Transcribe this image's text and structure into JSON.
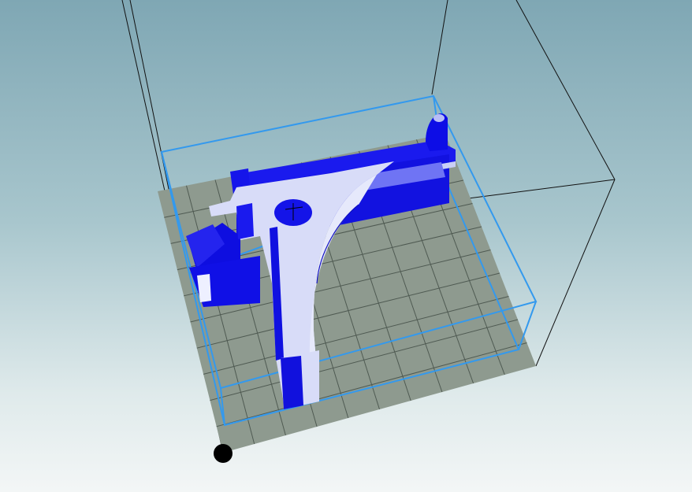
{
  "viewport": {
    "background_top": "#7fa7b4",
    "background_bottom": "#f3f6f6"
  },
  "build_plate": {
    "color": "#8e9a8f",
    "grid_color": "#4f5a52",
    "cells": 10
  },
  "model": {
    "primary_color": "#1010f0",
    "highlight_color": "#d8dcf8",
    "selection_color": "#3399ee"
  },
  "origin_marker": {
    "icon": "origin-dot-icon",
    "color": "#000000"
  }
}
